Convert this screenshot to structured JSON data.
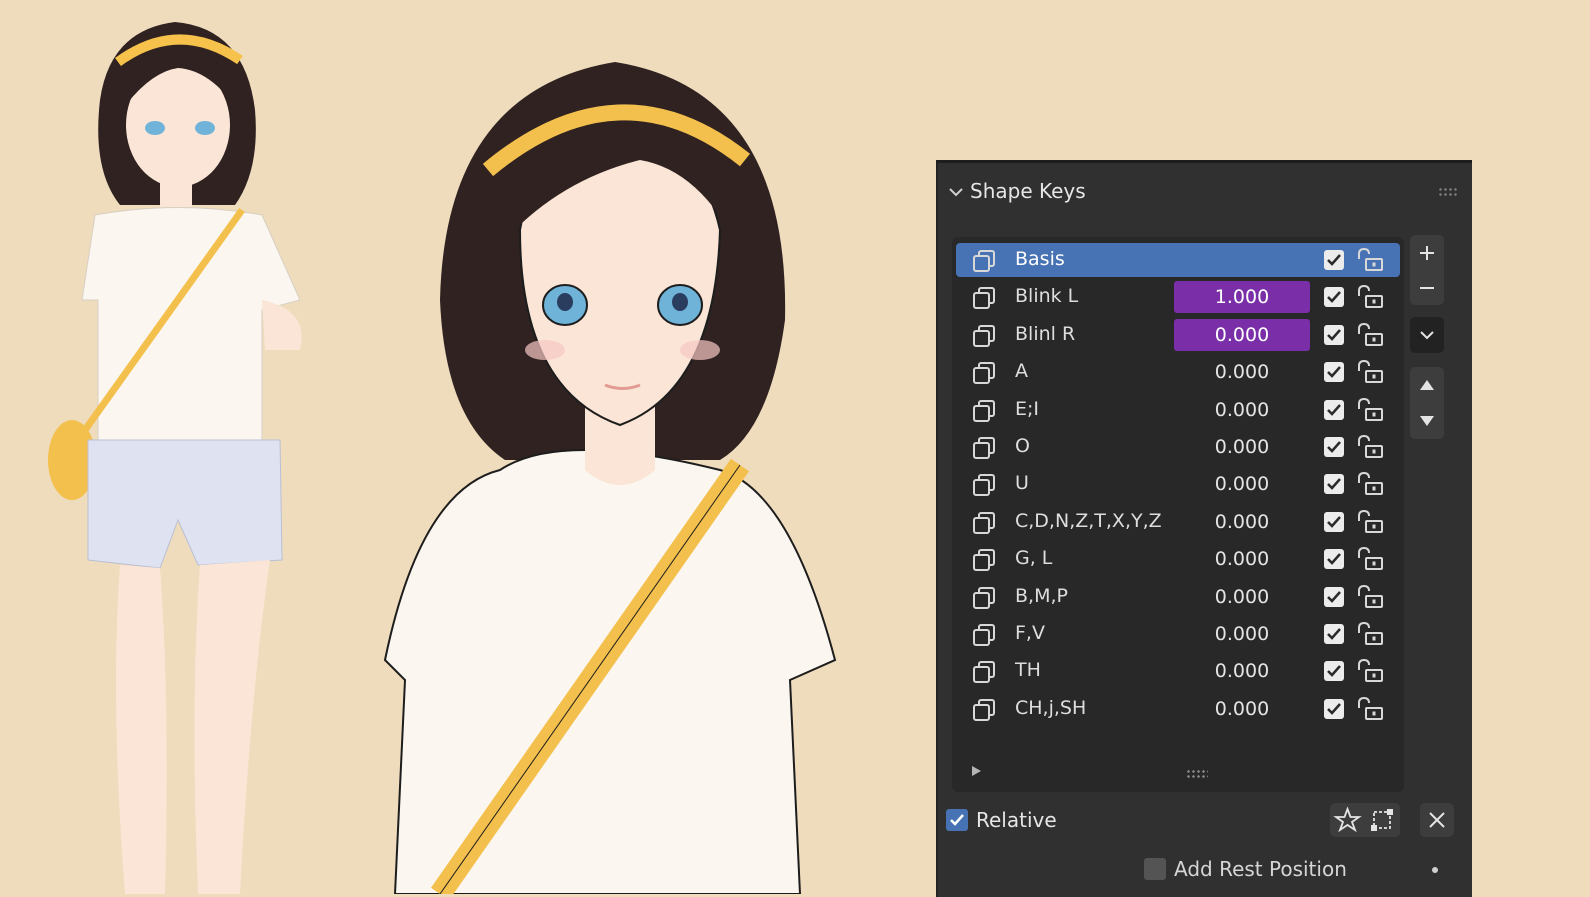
{
  "panel": {
    "title": "Shape Keys",
    "collapse_icon": "chevron-down-icon",
    "shape_keys": [
      {
        "name": "Basis",
        "value": "",
        "enabled": true,
        "active": true,
        "driven": false
      },
      {
        "name": "Blink L",
        "value": "1.000",
        "enabled": true,
        "active": false,
        "driven": true
      },
      {
        "name": "Blinl R",
        "value": "0.000",
        "enabled": true,
        "active": false,
        "driven": true
      },
      {
        "name": "A",
        "value": "0.000",
        "enabled": true,
        "active": false,
        "driven": false
      },
      {
        "name": "E;I",
        "value": "0.000",
        "enabled": true,
        "active": false,
        "driven": false
      },
      {
        "name": "O",
        "value": "0.000",
        "enabled": true,
        "active": false,
        "driven": false
      },
      {
        "name": "U",
        "value": "0.000",
        "enabled": true,
        "active": false,
        "driven": false
      },
      {
        "name": "C,D,N,Z,T,X,Y,Z",
        "value": "0.000",
        "enabled": true,
        "active": false,
        "driven": false
      },
      {
        "name": "G, L",
        "value": "0.000",
        "enabled": true,
        "active": false,
        "driven": false
      },
      {
        "name": "B,M,P",
        "value": "0.000",
        "enabled": true,
        "active": false,
        "driven": false
      },
      {
        "name": "F,V",
        "value": "0.000",
        "enabled": true,
        "active": false,
        "driven": false
      },
      {
        "name": "TH",
        "value": "0.000",
        "enabled": true,
        "active": false,
        "driven": false
      },
      {
        "name": "CH,j,SH",
        "value": "0.000",
        "enabled": true,
        "active": false,
        "driven": false
      }
    ],
    "side_buttons": [
      "plus-icon",
      "minus-icon",
      "chevron-down-icon",
      "triangle-up-icon",
      "triangle-down-icon"
    ],
    "relative": {
      "label": "Relative",
      "checked": true
    },
    "add_rest_position": {
      "label": "Add Rest Position",
      "checked": false
    }
  },
  "colors": {
    "background": "#eedcbd",
    "panel": "#303030",
    "list": "#282828",
    "active_row": "#4772b3",
    "driven_value": "#7a2fa8"
  }
}
